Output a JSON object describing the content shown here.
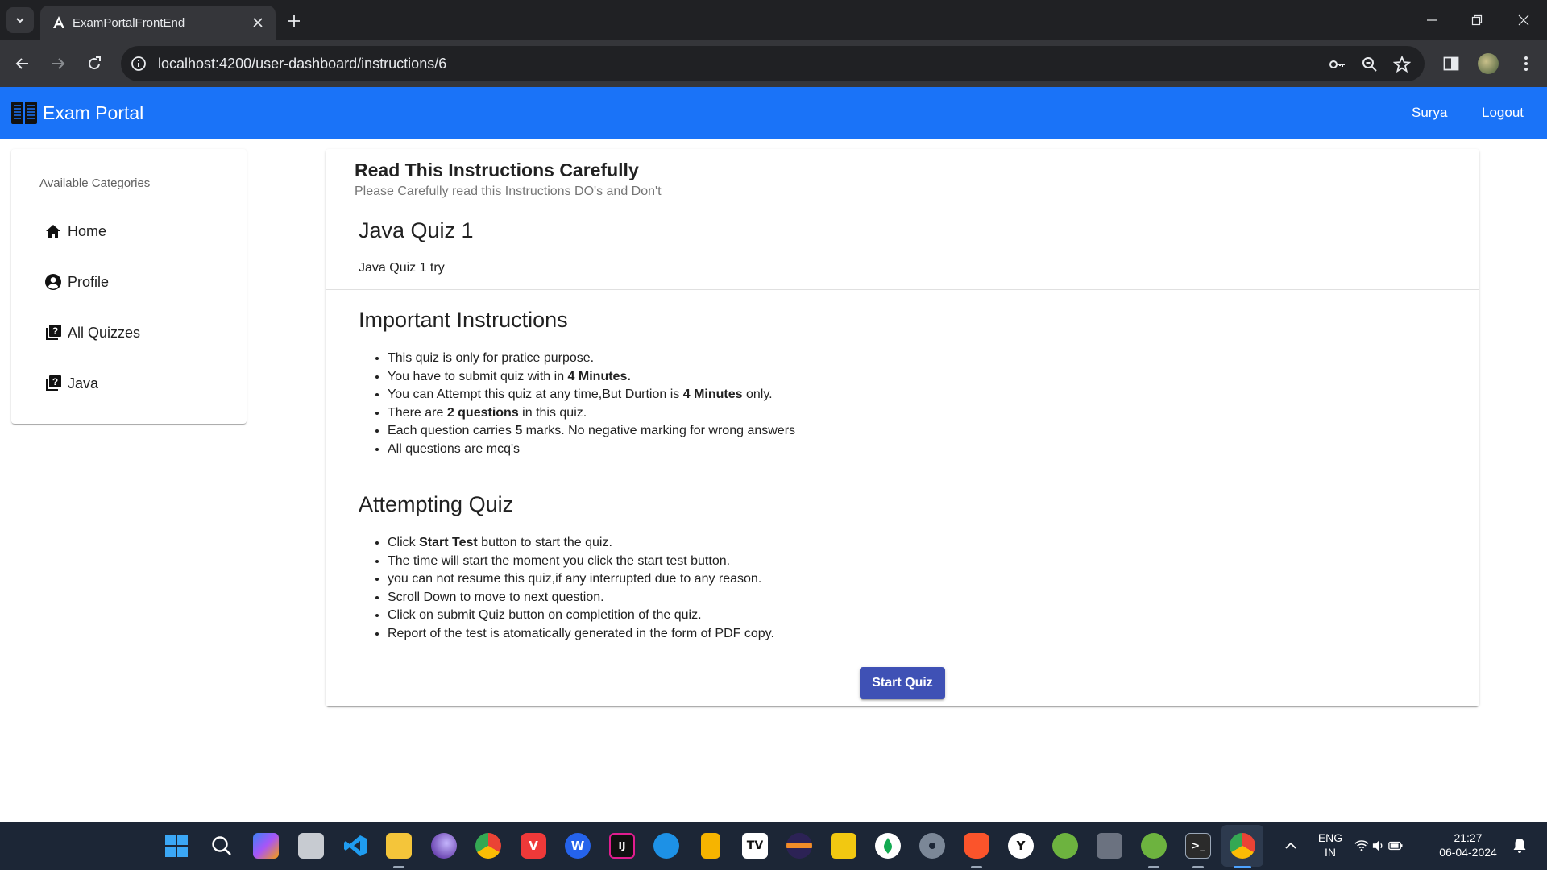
{
  "browser": {
    "tab_title": "ExamPortalFrontEnd",
    "url": "localhost:4200/user-dashboard/instructions/6"
  },
  "app": {
    "brand": "Exam Portal",
    "nav_links": [
      "Surya",
      "Logout"
    ]
  },
  "sidebar": {
    "header": "Available Categories",
    "items": [
      {
        "label": "Home",
        "icon": "home-icon"
      },
      {
        "label": "Profile",
        "icon": "account-circle-icon"
      },
      {
        "label": "All Quizzes",
        "icon": "quiz-icon"
      },
      {
        "label": "Java",
        "icon": "quiz-icon"
      }
    ]
  },
  "card": {
    "title": "Read This Instructions Carefully",
    "subtitle": "Please Carefully read this Instructions DO's and Don't",
    "quiz_title": "Java Quiz 1",
    "quiz_description": "Java Quiz 1 try",
    "important": {
      "title": "Important Instructions",
      "items": [
        {
          "pre": "This quiz is only for pratice purpose.",
          "bold": "",
          "post": ""
        },
        {
          "pre": "You have to submit quiz with in ",
          "bold": "4 Minutes.",
          "post": ""
        },
        {
          "pre": "You can Attempt this quiz at any time,But Durtion is ",
          "bold": "4 Minutes",
          "post": " only."
        },
        {
          "pre": "There are ",
          "bold": "2 questions",
          "post": " in this quiz."
        },
        {
          "pre": "Each question carries ",
          "bold": "5",
          "post": " marks. No negative marking for wrong answers"
        },
        {
          "pre": "All questions are mcq's",
          "bold": "",
          "post": ""
        }
      ]
    },
    "attempting": {
      "title": "Attempting Quiz",
      "items": [
        {
          "pre": "Click ",
          "bold": "Start Test",
          "post": " button to start the quiz."
        },
        {
          "pre": "The time will start the moment you click the start test button.",
          "bold": "",
          "post": ""
        },
        {
          "pre": "you can not resume this quiz,if any interrupted due to any reason.",
          "bold": "",
          "post": ""
        },
        {
          "pre": "Scroll Down to move to next question.",
          "bold": "",
          "post": ""
        },
        {
          "pre": "Click on submit Quiz button on completition of the quiz.",
          "bold": "",
          "post": ""
        },
        {
          "pre": "Report of the test is atomatically generated in the form of PDF copy.",
          "bold": "",
          "post": ""
        }
      ]
    },
    "start_button": "Start Quiz"
  },
  "taskbar": {
    "language_line1": "ENG",
    "language_line2": "IN",
    "time": "21:27",
    "date": "06-04-2024"
  },
  "colors": {
    "navbar": "#1a73f8",
    "button": "#3f51b5",
    "browser_dark": "#202124",
    "taskbar": "#1c2636"
  }
}
